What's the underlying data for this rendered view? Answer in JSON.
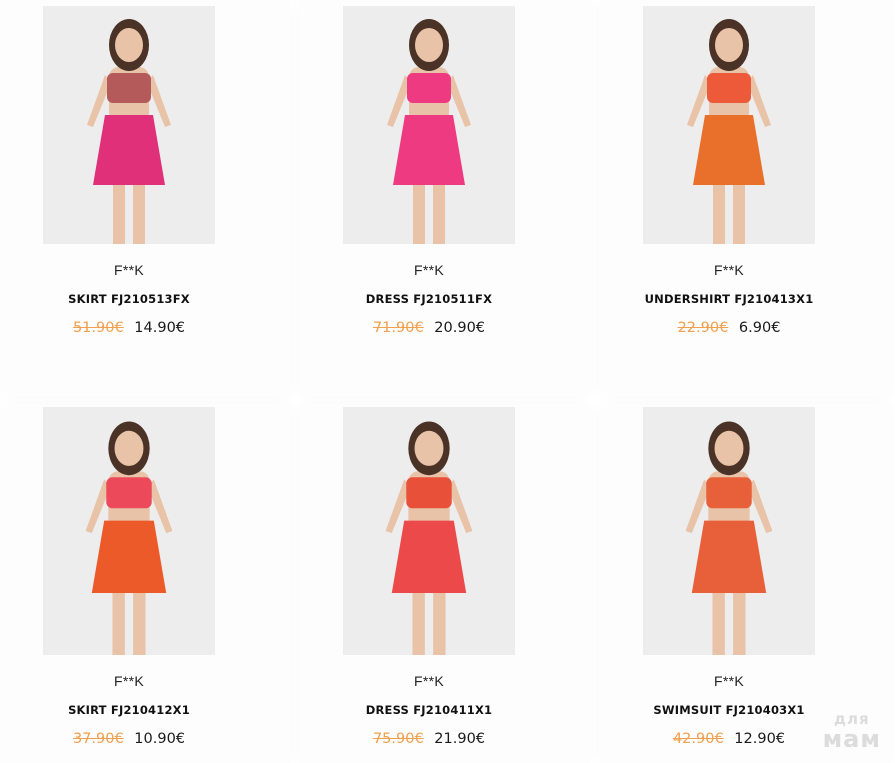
{
  "products": [
    {
      "brand": "F**K",
      "title": "SKIRT FJ210513FX",
      "old_price": "51.90€",
      "new_price": "14.90€",
      "image": {
        "name": "product-photo-skirt-pink",
        "top": "#b55a5a",
        "bottom": "#e0307a"
      }
    },
    {
      "brand": "F**K",
      "title": "DRESS FJ210511FX",
      "old_price": "71.90€",
      "new_price": "20.90€",
      "image": {
        "name": "product-photo-dress-pink",
        "top": "#ee3a80",
        "bottom": "#ee3a80"
      }
    },
    {
      "brand": "F**K",
      "title": "UNDERSHIRT FJ210413X1",
      "old_price": "22.90€",
      "new_price": "6.90€",
      "image": {
        "name": "product-photo-undershirt-print",
        "top": "#ec5a3a",
        "bottom": "#e8702a"
      }
    },
    {
      "brand": "F**K",
      "title": "SKIRT FJ210412X1",
      "old_price": "37.90€",
      "new_price": "10.90€",
      "image": {
        "name": "product-photo-skirt-print",
        "top": "#ec4a5a",
        "bottom": "#ec5a2a"
      }
    },
    {
      "brand": "F**K",
      "title": "DRESS FJ210411X1",
      "old_price": "75.90€",
      "new_price": "21.90€",
      "image": {
        "name": "product-photo-dress-print",
        "top": "#e8503a",
        "bottom": "#ec4a4a"
      }
    },
    {
      "brand": "F**K",
      "title": "SWIMSUIT FJ210403X1",
      "old_price": "42.90€",
      "new_price": "12.90€",
      "image": {
        "name": "product-photo-swimsuit-print",
        "top": "#e8603a",
        "bottom": "#e8603a"
      }
    }
  ],
  "watermark": {
    "line1": "для",
    "line2": "мам"
  },
  "colors": {
    "old_price": "#f0a04e",
    "new_price": "#1a1a1a",
    "photo_bg": "#ededed"
  }
}
